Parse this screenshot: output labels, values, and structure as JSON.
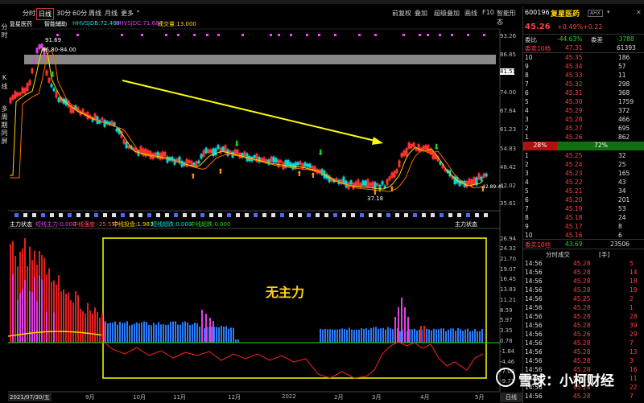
{
  "toolbar": {
    "tabs": [
      "分时",
      "日线",
      "30分",
      "60分",
      "周线",
      "月线",
      "更多"
    ],
    "active_tab": "日线",
    "right_controls": [
      "前复权",
      "叠加",
      "超级叠加",
      "画线",
      "F10",
      "智能形态"
    ]
  },
  "left_vertical": [
    "分",
    "时",
    "K",
    "线",
    "多",
    "周",
    "期",
    "同",
    "屏"
  ],
  "indicator_line": {
    "name": "复星医药",
    "tool": "智能辅助",
    "hhv": "HHVSJDB:72.460",
    "llv": "HHVSJDC:71.684",
    "hist": "成交量:13.000"
  },
  "price_axis": [
    "93.26",
    "86.85",
    "81.51",
    "74.00",
    "67.64",
    "61.23",
    "54.83",
    "48.42",
    "42.02",
    "35.61"
  ],
  "price_highlight": "81.51",
  "price_annotations": {
    "high": "91.69",
    "band": "86.80-84.00",
    "low": "37.18",
    "last": "42.89-41"
  },
  "lower_legend": {
    "name": "主力状态",
    "a": "短线主力:0.000",
    "b": "中线强度:-25.557",
    "c": "中线投盘:1.983",
    "d": "短线超跌:0.000",
    "e": "中线超跌:0.000",
    "right": "主力状态"
  },
  "lower_axis": [
    "26.94",
    "24.32",
    "21.70",
    "19.07",
    "16.45",
    "13.83",
    "11.21",
    "8.59",
    "5.97",
    "3.35",
    "0.78",
    "-1.84",
    "-4.46",
    "-7.09",
    "-9.71"
  ],
  "annotation_text": "无主力",
  "dates": [
    "2021/07/30/五",
    "9月",
    "10月",
    "11月",
    "12月",
    "2022",
    "2月",
    "3月",
    "4月",
    "5月"
  ],
  "stock": {
    "code": "600196",
    "name": "复星医药",
    "tag": "AHX",
    "price": "45.26",
    "pct": "+0.49%",
    "chg": "+0.22",
    "weibi_label": "委比",
    "weibi": "-44.63%",
    "weicha_label": "委差",
    "weicha": "-3788",
    "sell10_label": "委卖10档",
    "sell10_price": "47.31",
    "sell10_vol": "61393"
  },
  "asks": [
    {
      "lvl": "10",
      "price": "45.35",
      "vol": "186"
    },
    {
      "lvl": "9",
      "price": "45.34",
      "vol": "57"
    },
    {
      "lvl": "8",
      "price": "45.33",
      "vol": "11"
    },
    {
      "lvl": "7",
      "price": "45.32",
      "vol": "298"
    },
    {
      "lvl": "6",
      "price": "45.31",
      "vol": "368"
    },
    {
      "lvl": "5",
      "price": "45.30",
      "vol": "1759"
    },
    {
      "lvl": "4",
      "price": "45.29",
      "vol": "372"
    },
    {
      "lvl": "3",
      "price": "45.28",
      "vol": "466"
    },
    {
      "lvl": "2",
      "price": "45.27",
      "vol": "695"
    },
    {
      "lvl": "1",
      "price": "45.26",
      "vol": "862"
    }
  ],
  "ratio": {
    "left": "28%",
    "right": "72%"
  },
  "bids": [
    {
      "lvl": "1",
      "price": "45.25",
      "vol": "32"
    },
    {
      "lvl": "2",
      "price": "45.24",
      "vol": "25"
    },
    {
      "lvl": "3",
      "price": "45.23",
      "vol": "165"
    },
    {
      "lvl": "4",
      "price": "45.22",
      "vol": "43"
    },
    {
      "lvl": "5",
      "price": "45.21",
      "vol": "34"
    },
    {
      "lvl": "6",
      "price": "45.20",
      "vol": "201"
    },
    {
      "lvl": "7",
      "price": "45.19",
      "vol": "53"
    },
    {
      "lvl": "8",
      "price": "45.18",
      "vol": "24"
    },
    {
      "lvl": "9",
      "price": "45.17",
      "vol": "8"
    },
    {
      "lvl": "10",
      "price": "45.16",
      "vol": "6"
    }
  ],
  "buy10": {
    "label": "委买10档",
    "price": "43.69",
    "vol": "23506"
  },
  "trades_header": {
    "title": "分时成交",
    "unit": "[手]"
  },
  "trades": [
    {
      "t": "14:56",
      "p": "45.28",
      "v": "5"
    },
    {
      "t": "14:56",
      "p": "45.28",
      "v": "14"
    },
    {
      "t": "14:56",
      "p": "45.28",
      "v": "18"
    },
    {
      "t": "14:56",
      "p": "45.28",
      "v": "19"
    },
    {
      "t": "14:56",
      "p": "45.25",
      "v": "2"
    },
    {
      "t": "14:56",
      "p": "45.28",
      "v": "1"
    },
    {
      "t": "14:56",
      "p": "45.28",
      "v": "28"
    },
    {
      "t": "14:56",
      "p": "45.28",
      "v": "39"
    },
    {
      "t": "14:56",
      "p": "45.26",
      "v": "29"
    },
    {
      "t": "14:56",
      "p": "45.28",
      "v": "7"
    },
    {
      "t": "14:56",
      "p": "45.28",
      "v": "13"
    },
    {
      "t": "14:56",
      "p": "45.28",
      "v": "3"
    },
    {
      "t": "14:56",
      "p": "45.28",
      "v": "16"
    },
    {
      "t": "14:56",
      "p": "45.28",
      "v": "11"
    },
    {
      "t": "14:56",
      "p": "45.28",
      "v": "22"
    },
    {
      "t": "14:56",
      "p": "45.28",
      "v": "7"
    }
  ],
  "bottom_tab": "日线",
  "watermark": "雪球：小柯财经"
}
